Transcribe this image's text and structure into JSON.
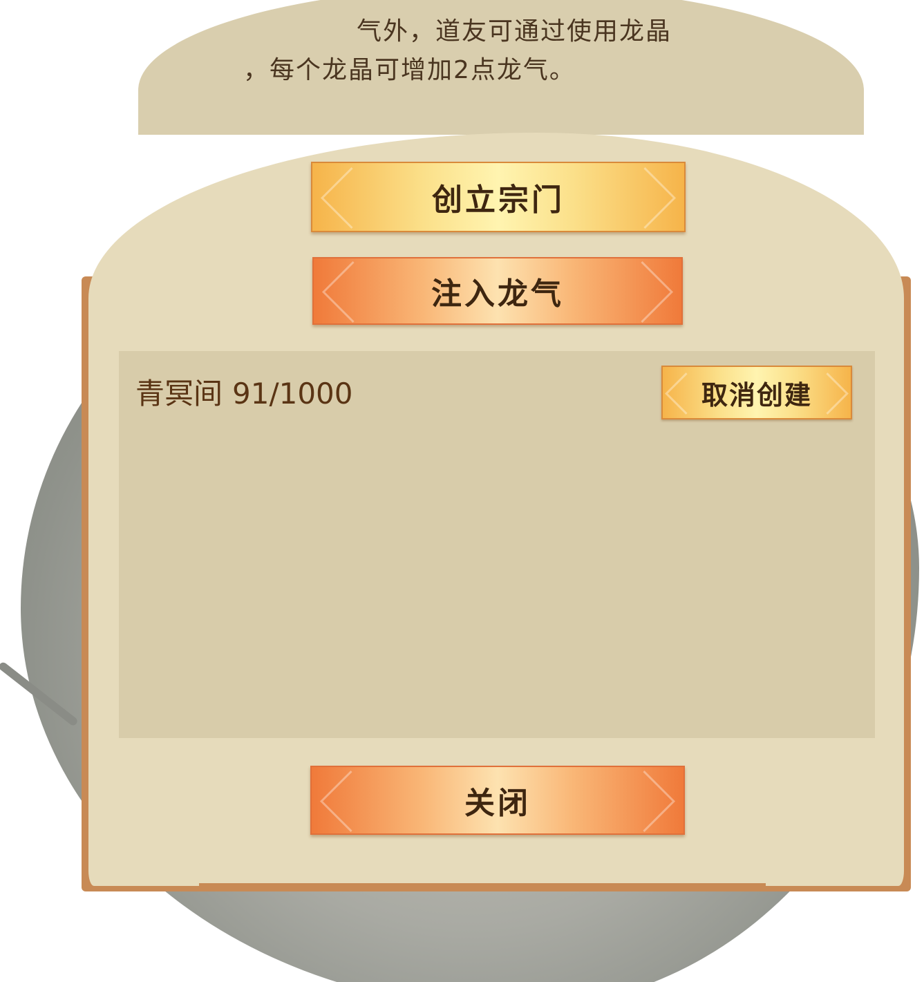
{
  "info_text": {
    "line1": "气外，道友可通过使用龙晶",
    "line2": "，每个龙晶可增加2点龙气。"
  },
  "buttons": {
    "create_sect": "创立宗门",
    "inject_dragon_qi": "注入龙气",
    "close": "关闭"
  },
  "sect_list": [
    {
      "name": "青冥间",
      "progress": "91/1000",
      "progress_value": 91,
      "progress_max": 1000,
      "action": "取消创建"
    }
  ],
  "colors": {
    "panel": "#e6dbbb",
    "list_bg": "#d8ccaa",
    "text_brown": "#5a3414",
    "gold_button": "#fbe08a",
    "orange_button": "#f07a3a"
  }
}
